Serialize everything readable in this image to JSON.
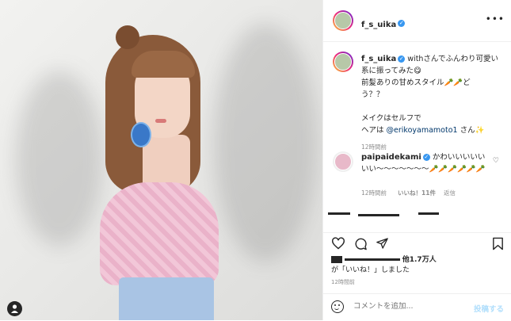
{
  "post": {
    "username": "f_s_uika",
    "more_icon": "more-icon",
    "caption_lines": [
      "withさんでふんわり可愛い",
      "系に振ってみた😋",
      "前髪ありの甘めスタイル🥕🥕ど",
      "う？？",
      "",
      "メイクはセルフで",
      "ヘアは",
      "さん✨"
    ],
    "caption_mention": "@erikoyamamoto1",
    "caption_time": "12時間前"
  },
  "comment": {
    "username": "paipaidekami",
    "text": "かわいいいいいいい〜〜〜〜〜〜〜🥕🥕🥕🥕🥕🥕",
    "time": "12時間前",
    "likes": "いいね！11件",
    "reply": "返信"
  },
  "likes": {
    "count": "他1.7万人",
    "suffix": "が「いいね！」しました"
  },
  "post_time": "12時間前",
  "comment_box": {
    "placeholder": "コメントを追加...",
    "post_label": "投稿する"
  },
  "colors": {
    "verified": "#3897f0",
    "link": "#00376b",
    "post_button": "#b2dffc"
  }
}
